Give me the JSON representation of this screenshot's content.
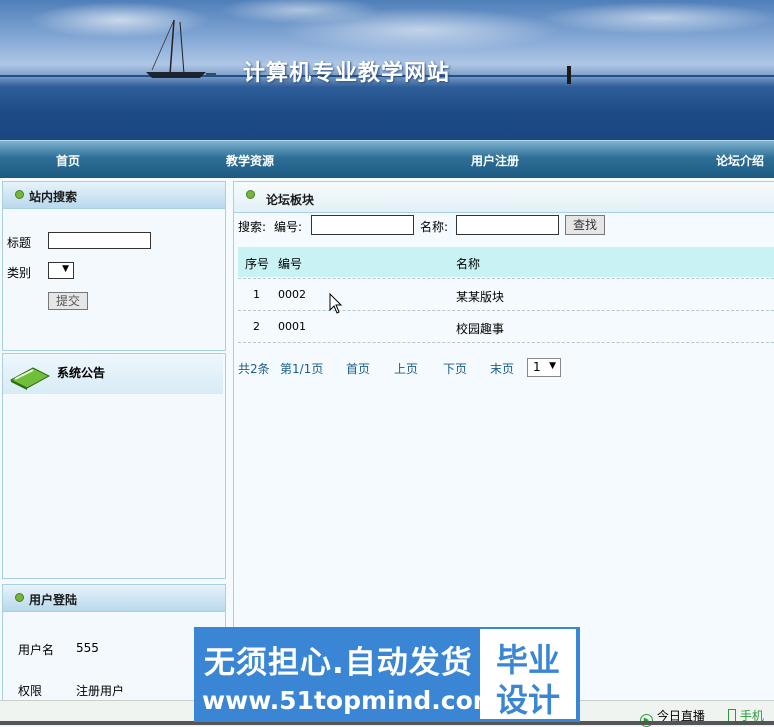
{
  "site": {
    "title": "计算机专业教学网站"
  },
  "nav": {
    "items": [
      "首页",
      "教学资源",
      "用户注册",
      "论坛介绍"
    ]
  },
  "search_panel": {
    "title": "站内搜索",
    "title_label": "标题",
    "title_value": "",
    "category_label": "类别",
    "category_value": "",
    "submit_label": "提交"
  },
  "notice_panel": {
    "title": "系统公告"
  },
  "login_panel": {
    "title": "用户登陆",
    "username_label": "用户名",
    "username_value": "555",
    "role_label": "权限",
    "role_value": "注册用户"
  },
  "forum": {
    "title": "论坛板块",
    "search_label": "搜索:",
    "number_label": "编号:",
    "number_value": "",
    "name_label": "名称:",
    "name_value": "",
    "find_label": "查找",
    "columns": {
      "seq": "序号",
      "number": "编号",
      "name": "名称"
    },
    "rows": [
      {
        "seq": "1",
        "number": "0002",
        "name": "某某版块"
      },
      {
        "seq": "2",
        "number": "0001",
        "name": "校园趣事"
      }
    ],
    "pager": {
      "total": "共2条",
      "page": "第1/1页",
      "first": "首页",
      "prev": "上页",
      "next": "下页",
      "last": "末页",
      "select_value": "1"
    }
  },
  "watermark": {
    "line1": "无须担心.自动发货",
    "line2": "www.51topmind.com",
    "badge_line1": "毕业",
    "badge_line2": "设计"
  },
  "statusbar": {
    "live": "今日直播",
    "mobile": "手机"
  },
  "colors": {
    "nav": "#2e6f97",
    "table_head": "#c9f2f4",
    "accent_link": "#1b5e8c",
    "watermark": "#3a86d4"
  }
}
